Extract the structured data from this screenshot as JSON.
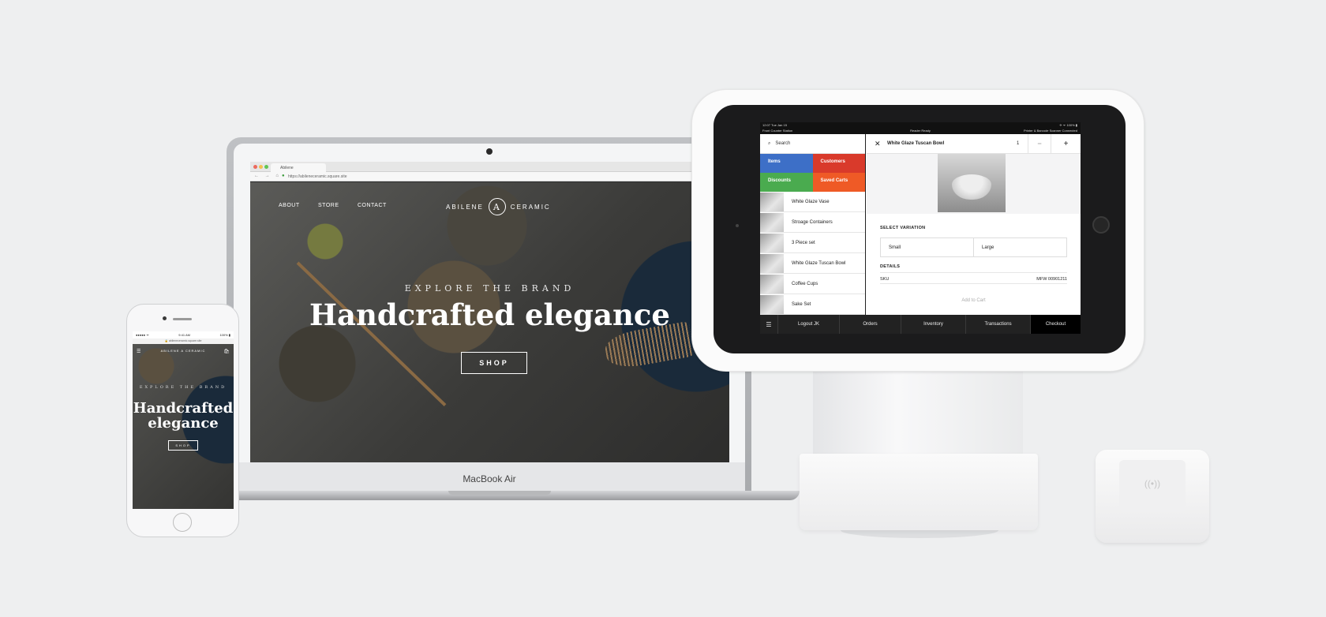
{
  "laptop": {
    "label": "MacBook Air",
    "browser": {
      "tab_title": "Abilene",
      "url": "https://abileneceramic.square.site",
      "nav_icons": "← → ⌂",
      "traffic_colors": [
        "#ec6a5e",
        "#f4bf4f",
        "#61c554"
      ]
    },
    "site": {
      "nav": [
        "ABOUT",
        "STORE",
        "CONTACT"
      ],
      "brand_left": "ABILENE",
      "brand_logo": "A",
      "brand_right": "CERAMIC",
      "eyebrow": "EXPLORE THE BRAND",
      "title": "Handcrafted elegance",
      "cta": "SHOP"
    }
  },
  "phone": {
    "status_left": "●●●●● ᯤ",
    "status_time": "9:41 AM",
    "status_right": "100% ▮",
    "url": "🔒 abileneceramic.square.site",
    "brand": "ABILENE  A  CERAMIC",
    "menu_icon": "☰",
    "bag_icon": "🛍",
    "eyebrow": "EXPLORE THE BRAND",
    "title": "Handcrafted elegance",
    "cta": "SHOP"
  },
  "pos": {
    "status": {
      "datetime": "12:07 Tue Jan 15",
      "station": "Front Counter Station",
      "center": "Reader Ready",
      "right": "Printer & Barcode Scanner Connected",
      "icons": "✈ ᯤ 100% ▮"
    },
    "search_icon": "⌕",
    "search_placeholder": "Search",
    "tiles": [
      {
        "label": "Items",
        "color": "#3d6fc7"
      },
      {
        "label": "Customers",
        "color": "#d93a2b"
      },
      {
        "label": "Discounts",
        "color": "#4aab4f"
      },
      {
        "label": "Saved Carts",
        "color": "#ef5a26"
      }
    ],
    "items": [
      "White Glaze Vase",
      "Stroage Containers",
      "3 Piece set",
      "White Glaze Tuscan Bowl",
      "Coffee Cups",
      "Sake Set"
    ],
    "detail": {
      "close_icon": "✕",
      "title": "White Glaze Tuscan Bowl",
      "quantity": "1",
      "minus": "−",
      "plus": "+",
      "variation_label": "SELECT VARIATION",
      "variations": [
        "Small",
        "Large"
      ],
      "details_label": "DETAILS",
      "sku_label": "SKU",
      "sku_value": "MFW 00901211",
      "add_to_cart": "Add to Cart"
    },
    "bottom_nav": {
      "menu_icon": "☰",
      "logout": "Logout JK",
      "orders": "Orders",
      "inventory": "Inventory",
      "transactions": "Transactions",
      "checkout": "Checkout"
    }
  },
  "reader": {
    "contactless_icon": "((•))"
  }
}
